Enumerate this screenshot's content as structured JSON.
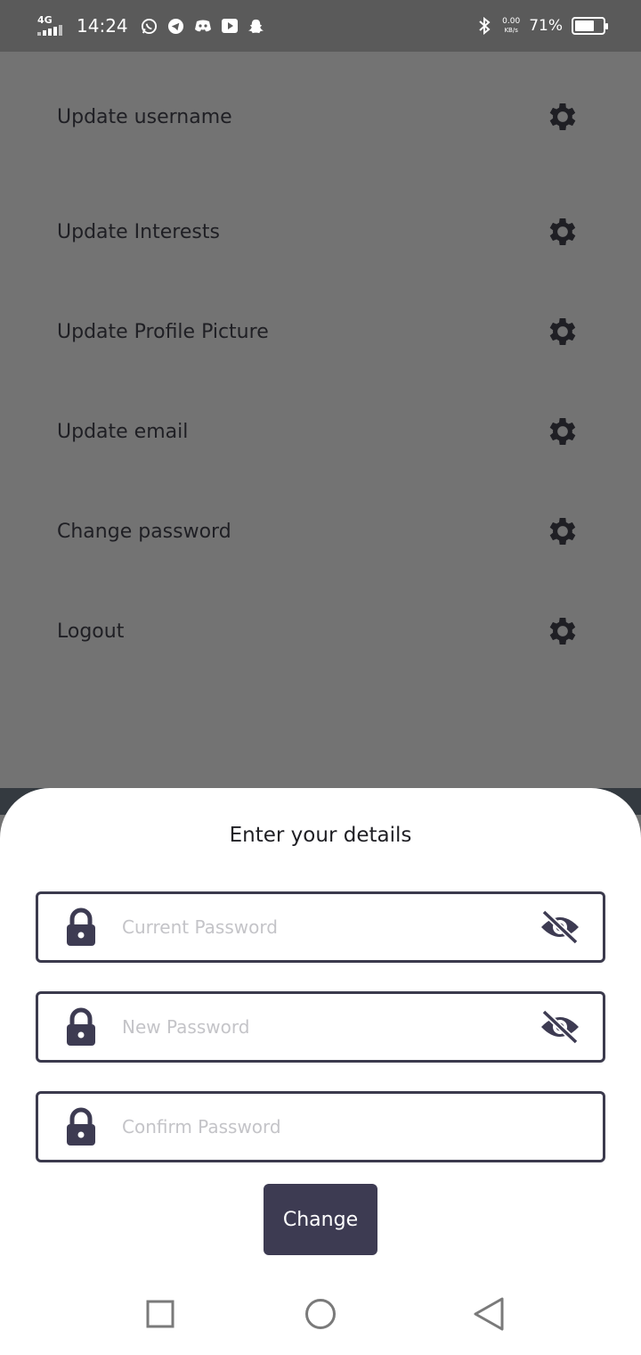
{
  "status_bar": {
    "network": "4G",
    "time": "14:24",
    "speed_value": "0.00",
    "speed_unit": "KB/s",
    "battery_percent": "71%",
    "battery_level": 0.71,
    "notification_icons": [
      "whatsapp-icon",
      "telegram-icon",
      "discord-icon",
      "youtube-icon",
      "snapchat-icon"
    ]
  },
  "settings": {
    "items": [
      {
        "label": "Update username"
      },
      {
        "label": "Update Interests"
      },
      {
        "label": "Update Profile Picture"
      },
      {
        "label": "Update email"
      },
      {
        "label": "Change password"
      },
      {
        "label": "Logout"
      }
    ]
  },
  "sheet": {
    "title": "Enter your details",
    "fields": {
      "current_password": {
        "placeholder": "Current Password",
        "value": ""
      },
      "new_password": {
        "placeholder": "New Password",
        "value": ""
      },
      "confirm_password": {
        "placeholder": "Confirm Password",
        "value": ""
      }
    },
    "submit_label": "Change"
  },
  "colors": {
    "accent": "#3d3b52",
    "overlay": "#737373",
    "status_bar": "#5a5a5a"
  }
}
